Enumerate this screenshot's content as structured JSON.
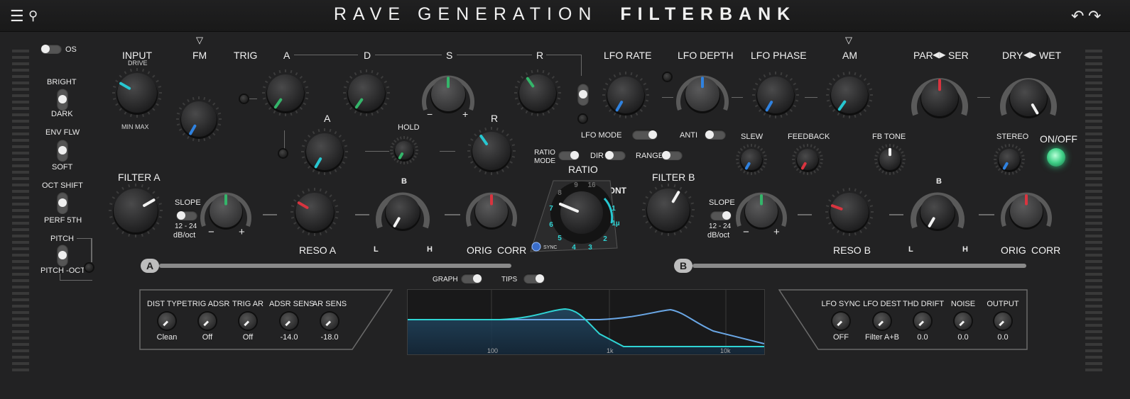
{
  "title": {
    "light": "RAVE GENERATION",
    "bold": "FILTERBANK"
  },
  "icons": [
    "menu-icon",
    "search-icon",
    "undo-icon",
    "redo-icon"
  ],
  "left_switches": {
    "os": "OS",
    "bright": "BRIGHT",
    "dark": "DARK",
    "env_flw": "ENV FLW",
    "soft": "SOFT",
    "oct_shift": "OCT SHIFT",
    "perf_5th": "PERF 5TH",
    "pitch": "PITCH",
    "pitch_oct": "PITCH -OCT"
  },
  "top_labels": {
    "input": "INPUT",
    "drive": "DRIVE",
    "min_max": "MIN MAX",
    "fm": "FM",
    "trig": "TRIG",
    "a": "A",
    "d": "D",
    "s": "S",
    "r": "R",
    "lfo_rate": "LFO RATE",
    "lfo_depth": "LFO DEPTH",
    "lfo_phase": "LFO PHASE",
    "am": "AM",
    "par": "PAR",
    "ser": "SER",
    "dry": "DRY",
    "wet": "WET"
  },
  "mid_labels": {
    "a2": "A",
    "hold": "HOLD",
    "r2": "R",
    "lfo_mode": "LFO MODE",
    "anti": "ANTI",
    "ratio_mode": "RATIO\nMODE",
    "dir": "DIR",
    "range": "RANGE",
    "ratio": "RATIO",
    "cont": "CONT",
    "slew": "SLEW",
    "feedback": "FEEDBACK",
    "fb_tone": "FB TONE",
    "stereo": "STEREO",
    "on_off": "ON/OFF",
    "s_minus": "−",
    "s_plus": "+"
  },
  "ratio_dial": [
    "9",
    "16",
    "8",
    "7",
    "6",
    "5",
    "4",
    "3",
    "2",
    "1",
    "1µ"
  ],
  "ratio_sync": "SYNC",
  "filter_a": {
    "title": "FILTER A",
    "slope": "SLOPE",
    "slope_range": "12 - 24",
    "slope_unit": "dB/oct",
    "reso": "RESO A",
    "orig": "ORIG",
    "corr": "CORR",
    "badge": "A",
    "minus": "−",
    "plus": "+",
    "l": "L",
    "h": "H",
    "b": "B"
  },
  "filter_b": {
    "title": "FILTER B",
    "slope": "SLOPE",
    "slope_range": "12 - 24",
    "slope_unit": "dB/oct",
    "reso": "RESO B",
    "orig": "ORIG",
    "corr": "CORR",
    "badge": "B",
    "minus": "−",
    "plus": "+",
    "l": "L",
    "h": "H",
    "b": "B"
  },
  "graph_toggles": {
    "graph": "GRAPH",
    "tips": "TIPS"
  },
  "graph_axis": [
    "100",
    "1k",
    "10k"
  ],
  "bottom_left": [
    {
      "label": "DIST TYPE",
      "value": "Clean"
    },
    {
      "label": "TRIG ADSR",
      "value": "Off"
    },
    {
      "label": "TRIG AR",
      "value": "Off"
    },
    {
      "label": "ADSR SENS",
      "value": "-14.0"
    },
    {
      "label": "AR SENS",
      "value": "-18.0"
    }
  ],
  "bottom_right": [
    {
      "label": "LFO SYNC",
      "value": "OFF"
    },
    {
      "label": "LFO DEST",
      "value": "Filter A+B"
    },
    {
      "label": "THD DRIFT",
      "value": "0.0"
    },
    {
      "label": "NOISE",
      "value": "0.0"
    },
    {
      "label": "OUTPUT",
      "value": "0.0"
    }
  ],
  "colors": {
    "cyan": "#27c7d1",
    "green": "#34b56a",
    "blue": "#2f82e0",
    "red": "#d9343f",
    "white": "#f2f2f2",
    "onoff": "#3ecf86"
  }
}
